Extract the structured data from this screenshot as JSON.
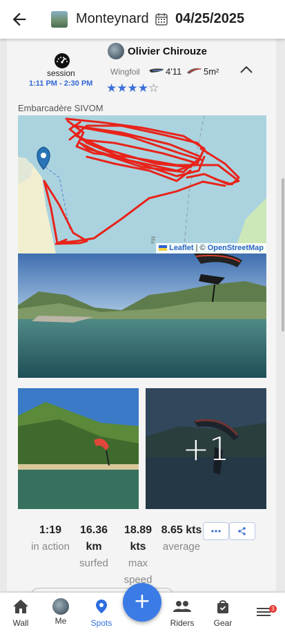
{
  "header": {
    "spot_name": "Monteynard",
    "date": "04/25/2025"
  },
  "session": {
    "label": "session",
    "time_range": "1:11 PM - 2:30 PM",
    "rider_name": "Olivier Chirouze",
    "sport": "Wingfoil",
    "board_size": "4'11",
    "wing_size": "5m²",
    "rating": 4,
    "rating_max": 5,
    "location": "Embarcadère SIVOM"
  },
  "map": {
    "attribution_leaflet": "Leaflet",
    "attribution_sep": " | © ",
    "attribution_osm": "OpenStreetMap",
    "track_color": "#e8231a"
  },
  "photos": {
    "more_count": "+1"
  },
  "stats": [
    {
      "value": "1:19",
      "label": "in action"
    },
    {
      "value": "16.36",
      "value2": "km",
      "label": "surfed"
    },
    {
      "value": "18.89",
      "value2": "kts",
      "label": "max",
      "label2": "speed"
    },
    {
      "value": "8.65 kts",
      "label": "average"
    }
  ],
  "actions": {
    "more_icon": "ellipsis-icon",
    "share_icon": "share-icon"
  },
  "fab": {
    "label": "+"
  },
  "bottom_nav": [
    {
      "label": "Wall",
      "icon": "home-icon"
    },
    {
      "label": "Me",
      "icon": "avatar"
    },
    {
      "label": "Spots",
      "icon": "map-pin-icon",
      "active": true
    },
    {
      "label": "Riders",
      "icon": "group-icon"
    },
    {
      "label": "Gear",
      "icon": "bag-icon"
    }
  ],
  "notifications": {
    "count": "3"
  },
  "colors": {
    "accent": "#3b7be6",
    "star": "#3a6fd8",
    "time": "#3367d6"
  }
}
